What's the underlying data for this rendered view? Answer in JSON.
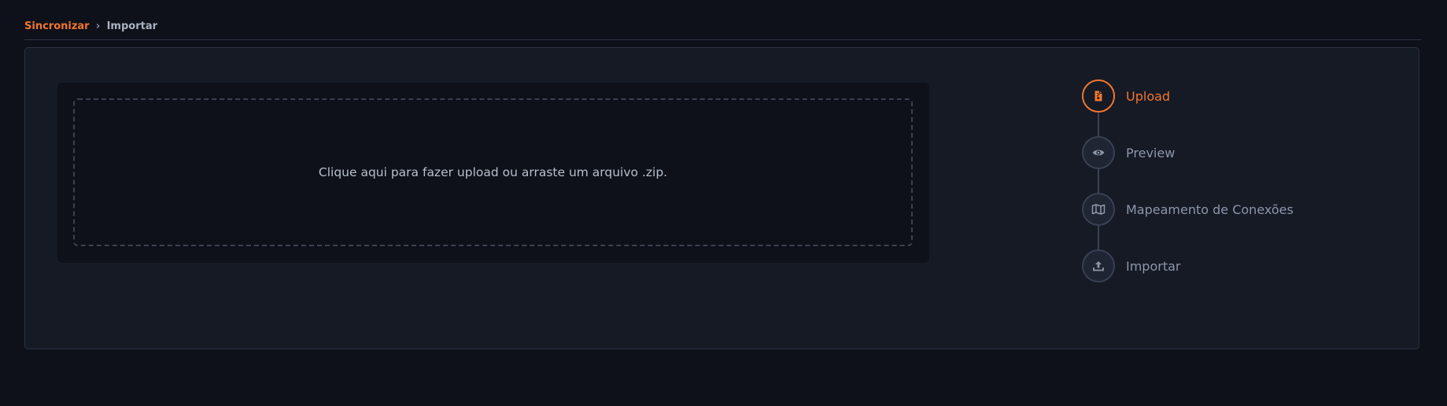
{
  "breadcrumb": {
    "parent": "Sincronizar",
    "separator": "›",
    "current": "Importar"
  },
  "upload": {
    "dropzone_text": "Clique aqui para fazer upload ou arraste um arquivo .zip."
  },
  "steps": [
    {
      "label": "Upload",
      "icon": "zip-file-icon",
      "active": true
    },
    {
      "label": "Preview",
      "icon": "eye-icon",
      "active": false
    },
    {
      "label": "Mapeamento de Conexões",
      "icon": "map-icon",
      "active": false
    },
    {
      "label": "Importar",
      "icon": "upload-icon",
      "active": false
    }
  ],
  "colors": {
    "accent": "#f2762e",
    "background": "#0e111a",
    "card": "#151a25",
    "muted_text": "#8d96a8"
  }
}
